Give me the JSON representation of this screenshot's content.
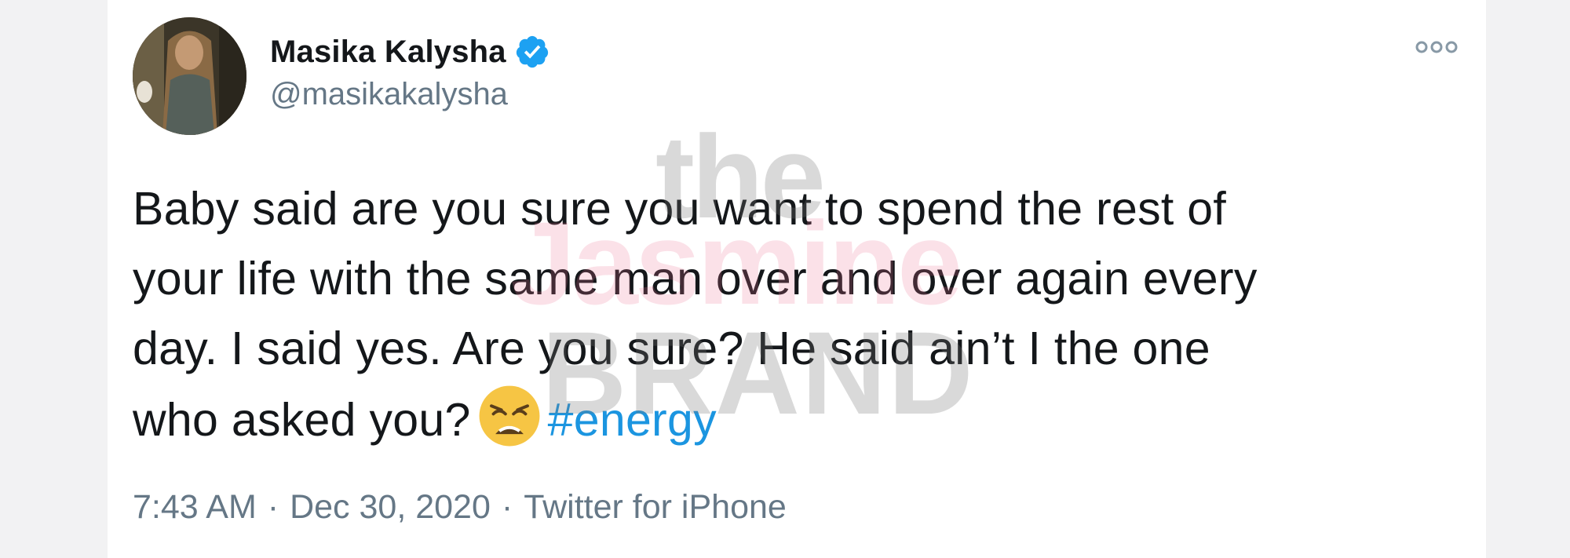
{
  "tweet": {
    "display_name": "Masika Kalysha",
    "handle": "@masikakalysha",
    "verified": true,
    "text_lines": [
      "Baby said are you sure you want to spend the rest of",
      "your life with the same man over and over again every",
      "day. I said yes. Are you sure? He said ain’t I the one",
      "who asked you?"
    ],
    "emoji_icon": "weary-face-emoji",
    "hashtag": "#energy",
    "time": "7:43 AM",
    "date": "Dec 30, 2020",
    "separator": "·",
    "source": "Twitter for iPhone"
  },
  "watermark": {
    "line1": "the",
    "line2": "Jasmine",
    "line3": "BRAND"
  },
  "colors": {
    "background": "#f2f2f3",
    "card": "#ffffff",
    "text": "#14171a",
    "secondary": "#657786",
    "link": "#1b95e0",
    "verified": "#1da1f2"
  }
}
